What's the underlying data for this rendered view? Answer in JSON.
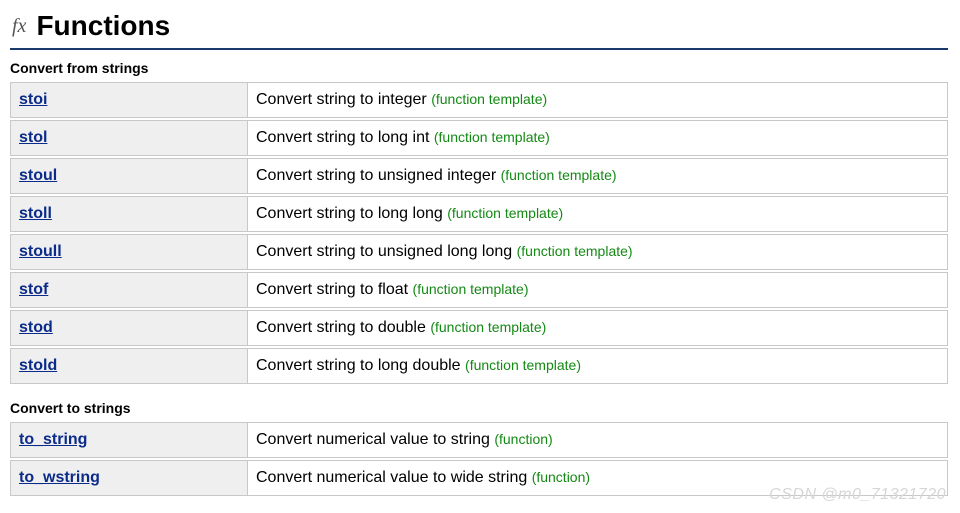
{
  "header": {
    "fx_label": "fx",
    "title": "Functions"
  },
  "sections": [
    {
      "title": "Convert from strings",
      "rows": [
        {
          "name": "stoi",
          "desc": "Convert string to integer",
          "tag": "(function template)"
        },
        {
          "name": "stol",
          "desc": "Convert string to long int",
          "tag": "(function template)"
        },
        {
          "name": "stoul",
          "desc": "Convert string to unsigned integer",
          "tag": "(function template)"
        },
        {
          "name": "stoll",
          "desc": "Convert string to long long",
          "tag": "(function template)"
        },
        {
          "name": "stoull",
          "desc": "Convert string to unsigned long long",
          "tag": "(function template)"
        },
        {
          "name": "stof",
          "desc": "Convert string to float",
          "tag": "(function template)"
        },
        {
          "name": "stod",
          "desc": "Convert string to double",
          "tag": "(function template)"
        },
        {
          "name": "stold",
          "desc": "Convert string to long double",
          "tag": "(function template)"
        }
      ]
    },
    {
      "title": "Convert to strings",
      "rows": [
        {
          "name": "to_string",
          "desc": "Convert numerical value to string",
          "tag": "(function)"
        },
        {
          "name": "to_wstring",
          "desc": "Convert numerical value to wide string",
          "tag": "(function)"
        }
      ]
    }
  ],
  "watermark": "CSDN @m0_71321720"
}
